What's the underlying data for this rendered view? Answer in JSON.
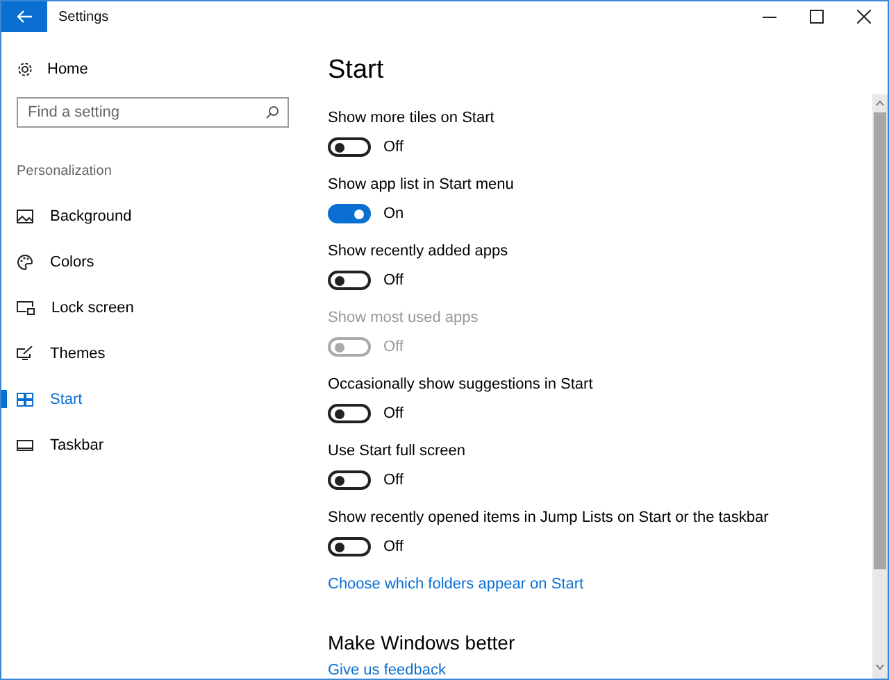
{
  "window": {
    "title": "Settings"
  },
  "sidebar": {
    "home": "Home",
    "search": {
      "placeholder": "Find a setting"
    },
    "section": "Personalization",
    "items": [
      {
        "label": "Background",
        "selected": false
      },
      {
        "label": "Colors",
        "selected": false
      },
      {
        "label": "Lock screen",
        "selected": false
      },
      {
        "label": "Themes",
        "selected": false
      },
      {
        "label": "Start",
        "selected": true
      },
      {
        "label": "Taskbar",
        "selected": false
      }
    ]
  },
  "page": {
    "title": "Start",
    "settings": [
      {
        "label": "Show more tiles on Start",
        "on": false,
        "disabled": false,
        "status": "Off"
      },
      {
        "label": "Show app list in Start menu",
        "on": true,
        "disabled": false,
        "status": "On"
      },
      {
        "label": "Show recently added apps",
        "on": false,
        "disabled": false,
        "status": "Off"
      },
      {
        "label": "Show most used apps",
        "on": false,
        "disabled": true,
        "status": "Off"
      },
      {
        "label": "Occasionally show suggestions in Start",
        "on": false,
        "disabled": false,
        "status": "Off"
      },
      {
        "label": "Use Start full screen",
        "on": false,
        "disabled": false,
        "status": "Off"
      },
      {
        "label": "Show recently opened items in Jump Lists on Start or the taskbar",
        "on": false,
        "disabled": false,
        "status": "Off"
      }
    ],
    "link": "Choose which folders appear on Start",
    "section": {
      "title": "Make Windows better",
      "link": "Give us feedback"
    }
  }
}
